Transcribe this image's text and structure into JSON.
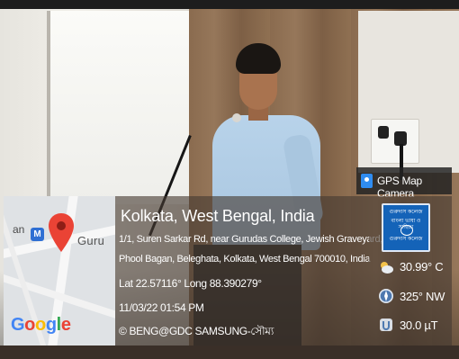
{
  "gps_badge": {
    "text": "GPS Map Camera"
  },
  "map": {
    "label_left": "an",
    "label_right": "Guru",
    "metro_label": "M",
    "google_letters": [
      "G",
      "o",
      "o",
      "g",
      "l",
      "e"
    ]
  },
  "info": {
    "location_title": "Kolkata, West Bengal, India",
    "address_line1": "1/1, Suren Sarkar Rd, near Gurudas College, Jewish Graveyard,",
    "address_line2": "Phool Bagan, Beleghata, Kolkata, West Bengal 700010, India",
    "latlong": "Lat 22.57116° Long 88.390279°",
    "datetime": "11/03/22 01:54 PM",
    "credit": "© BENG@GDC SAMSUNG-সৌম্য"
  },
  "metrics": {
    "temperature": "30.99° C",
    "direction": "325° NW",
    "magnetic": "30.0 µT"
  },
  "college_logo": {
    "line1": "গুরুদাস কলেজ",
    "line2": "বাংলা ভাষা ও সাহিত্য",
    "line3": "গুরুদাস কলেজ"
  },
  "colors": {
    "overlay": "#463a32",
    "badge": "#222222",
    "accent_blue": "#2f8cf0",
    "pin_red": "#ea4335"
  },
  "icons": [
    "gps-camera-icon",
    "map-pin-icon",
    "metro-icon",
    "weather-cloud-icon",
    "compass-icon",
    "magnetic-field-icon"
  ]
}
